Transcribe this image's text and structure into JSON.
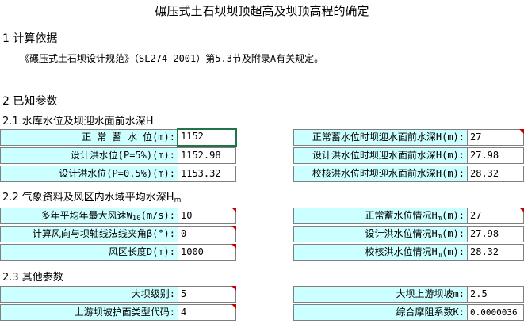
{
  "title": "碾压式土石坝坝顶超高及坝顶高程的确定",
  "section1": {
    "heading": "1 计算依据",
    "basis": "《碾压式土石坝设计规范》（SL274-2001）第5.3节及附录A有关规定。"
  },
  "section2": {
    "heading": "2 已知参数",
    "sub1": {
      "heading": "2.1 水库水位及坝迎水面前水深H",
      "rows": [
        {
          "left_label": "正 常 蓄 水 位(m):",
          "left_value": "1152",
          "right_label": "正常蓄水位时坝迎水面前水深H(m):",
          "right_value": "27"
        },
        {
          "left_label": "设计洪水位(P=5%)(m):",
          "left_value": "1152.98",
          "right_label": "设计洪水位时坝迎水面前水深H(m):",
          "right_value": "27.98"
        },
        {
          "left_label": "设计洪水位(P=0.5%)(m):",
          "left_value": "1153.32",
          "right_label": "校核洪水位时坝迎水面前水深H(m):",
          "right_value": "28.32"
        }
      ]
    },
    "sub2": {
      "heading_main": "2.2 气象资料及风区内水域平均水深H",
      "heading_sub": "m",
      "rows": [
        {
          "left_label_main": "多年平均年最大风速W",
          "left_label_sub": "10",
          "left_label_tail": "(m/s):",
          "left_value": "10",
          "right_label_main": "正常蓄水位情况H",
          "right_label_sub": "m",
          "right_label_tail": "(m):",
          "right_value": "27"
        },
        {
          "left_label_main": "计算风向与坝轴线法线夹角β(°):",
          "left_label_sub": "",
          "left_label_tail": "",
          "left_value": "0",
          "right_label_main": "设计洪水位情况H",
          "right_label_sub": "m",
          "right_label_tail": "(m):",
          "right_value": "27.98"
        },
        {
          "left_label_main": "风区长度D(m):",
          "left_label_sub": "",
          "left_label_tail": "",
          "left_value": "1000",
          "right_label_main": "校核洪水位情况H",
          "right_label_sub": "m",
          "right_label_tail": "(m):",
          "right_value": "28.32"
        }
      ]
    },
    "sub3": {
      "heading": "2.3 其他参数",
      "rows": [
        {
          "left_label": "大坝级别:",
          "left_value": "5",
          "right_label": "大坝上游坝坡m:",
          "right_value": "2.5"
        },
        {
          "left_label": "上游坝坡护面类型代码:",
          "left_value": "4",
          "right_label": "综合摩阻系数K:",
          "right_value": "0.0000036"
        }
      ]
    }
  },
  "colors": {
    "label_bg": "#ccffff",
    "comment_marker": "#c00000",
    "selection_border": "#21734a"
  }
}
